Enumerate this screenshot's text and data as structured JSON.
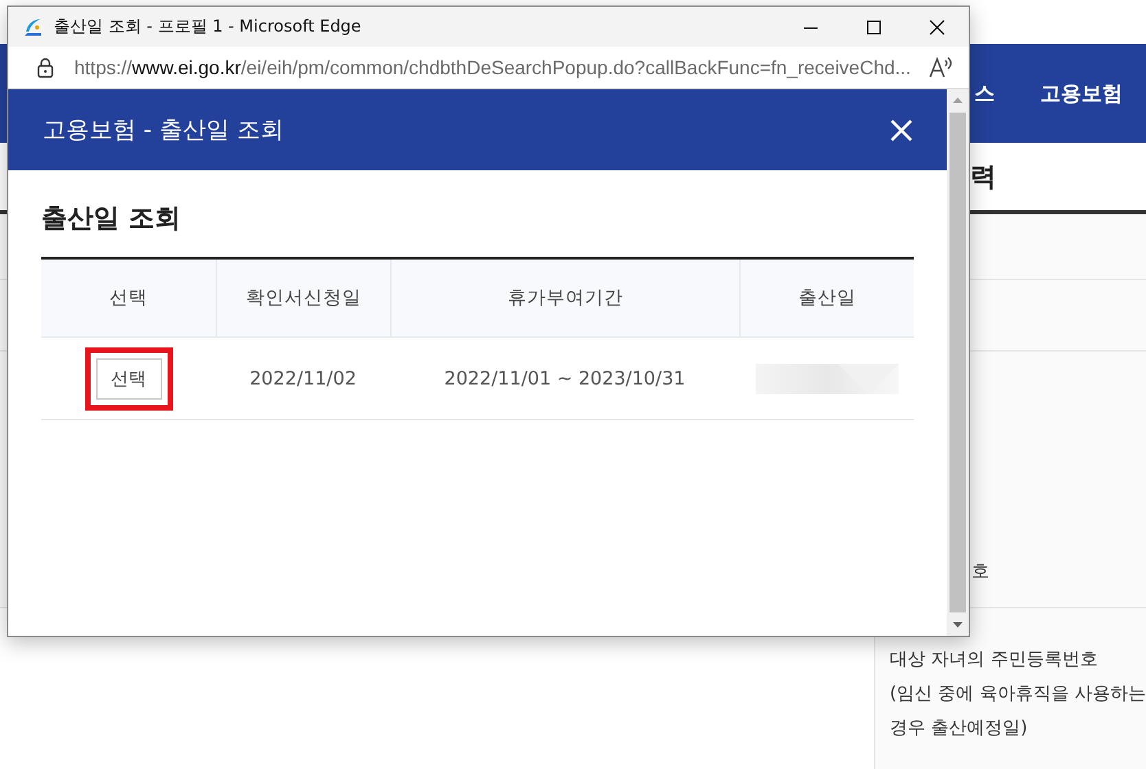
{
  "browser_window": {
    "title": "출산일 조회 - 프로필 1 - Microsoft Edge",
    "url": {
      "scheme": "https://",
      "host": "www.ei.go.kr",
      "path": "/ei/eih/pm/common/chdbthDeSearchPopup.do?callBackFunc=fn_receiveChd..."
    }
  },
  "popup": {
    "title": "고용보험 - 출산일 조회",
    "section_title": "출산일 조회",
    "table": {
      "columns": [
        "선택",
        "확인서신청일",
        "휴가부여기간",
        "출산일"
      ],
      "rows": [
        {
          "select_button": "선택",
          "highlighted": true,
          "request_date": "2022/11/02",
          "leave_period": "2022/11/01 ~ 2023/10/31",
          "birth_date_redacted": true
        }
      ]
    }
  },
  "background_page": {
    "nav_items": [
      "스",
      "고용보험"
    ],
    "heading": "력",
    "label_fragment": "호",
    "notes": [
      "대상 자녀의 주민등록번호",
      "(임신 중에 육아휴직을 사용하는",
      "경우 출산예정일)"
    ]
  }
}
